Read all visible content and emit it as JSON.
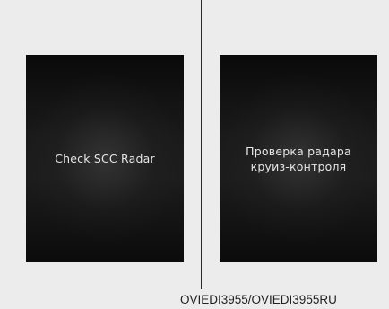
{
  "left_display": {
    "message": "Check SCC Radar"
  },
  "right_display": {
    "message": "Проверка радара\nкруиз-контроля"
  },
  "caption": "OVIEDI3955/OVIEDI3955RU"
}
